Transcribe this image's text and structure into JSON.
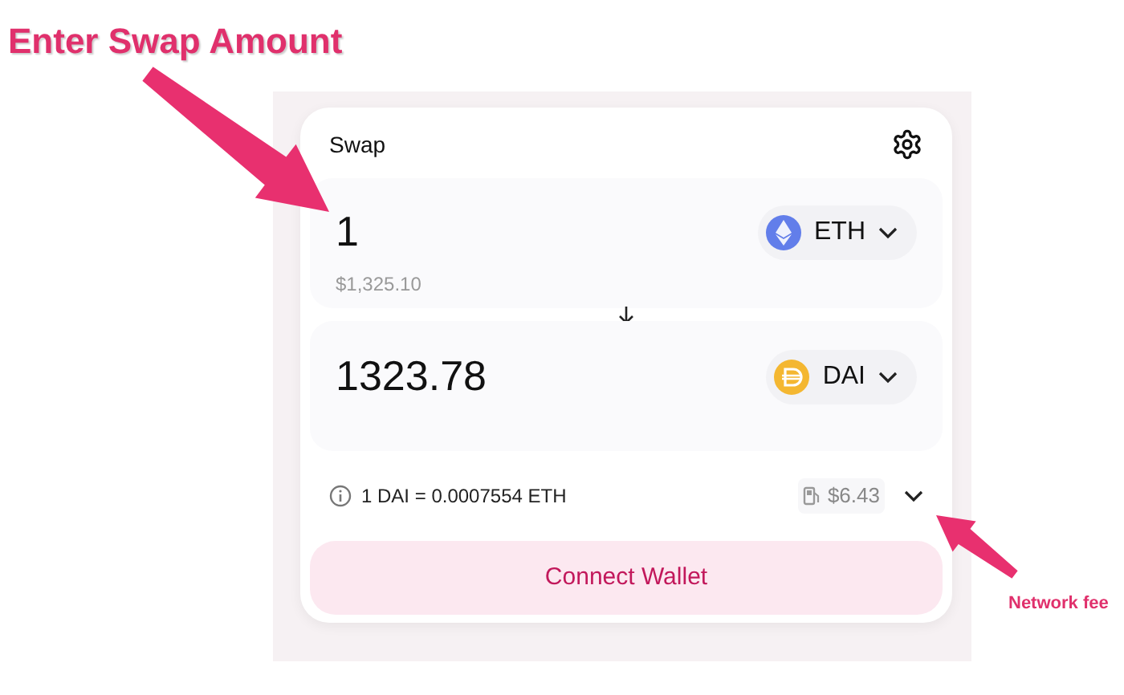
{
  "annotations": [
    {
      "text": "Enter Swap Amount"
    },
    {
      "text": "Network fee"
    }
  ],
  "swap": {
    "title": "Swap",
    "input": {
      "amount": "1",
      "usd": "$1,325.10",
      "token": "ETH"
    },
    "output": {
      "amount": "1323.78",
      "token": "DAI"
    },
    "rate": "1 DAI = 0.0007554 ETH",
    "fee": "$6.43",
    "button": "Connect Wallet"
  }
}
